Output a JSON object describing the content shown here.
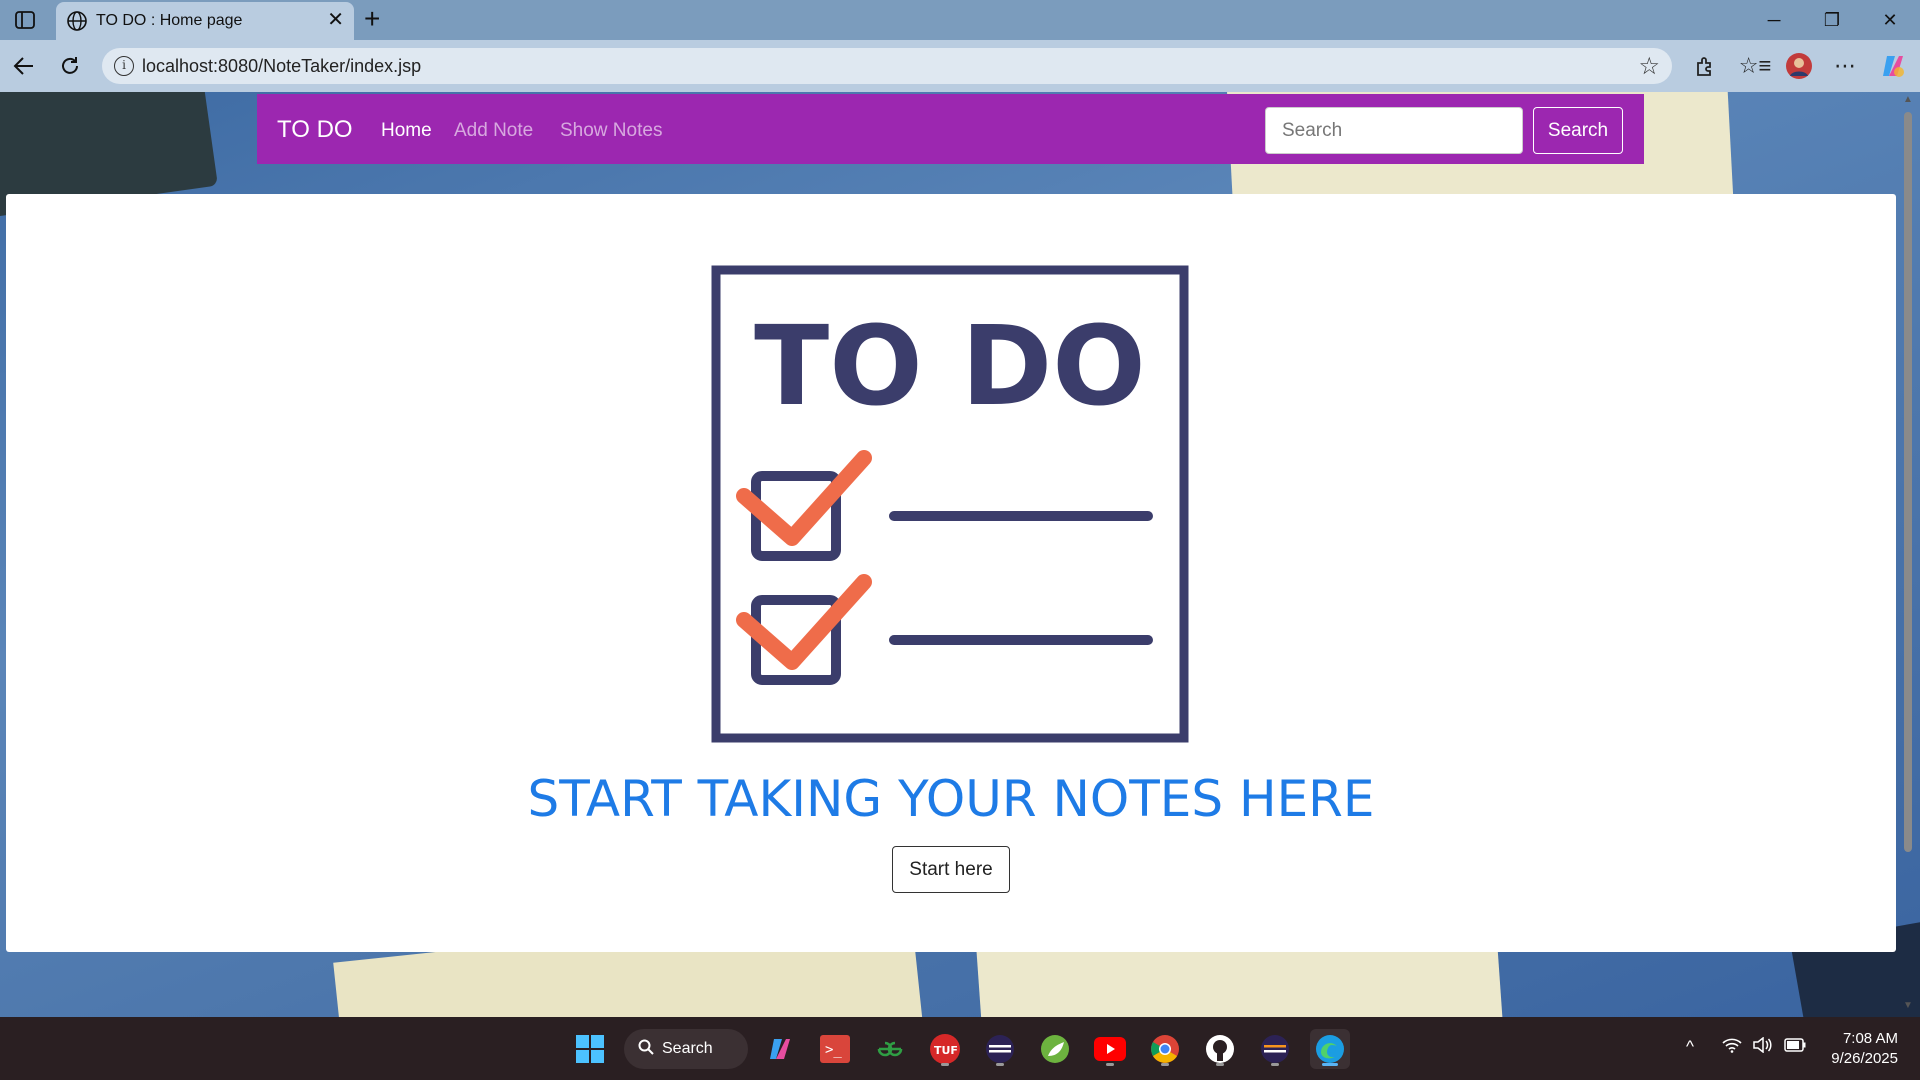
{
  "browser": {
    "tab_title": "TO DO : Home page",
    "url": "localhost:8080/NoteTaker/index.jsp"
  },
  "navbar": {
    "brand": "TO DO",
    "links": [
      {
        "label": "Home",
        "active": true
      },
      {
        "label": "Add Note",
        "active": false
      },
      {
        "label": "Show Notes",
        "active": false
      }
    ],
    "search_placeholder": "Search",
    "search_button": "Search",
    "color": "#9c27b0"
  },
  "main": {
    "illustration_title": "TO DO",
    "headline": "START TAKING YOUR NOTES HERE",
    "start_button": "Start here",
    "headline_color": "#1e7be6",
    "illustration_colors": {
      "ink": "#3b3d6b",
      "check": "#ef6c4a"
    }
  },
  "taskbar": {
    "search_label": "Search",
    "apps": [
      "copilot-icon",
      "terminal-icon",
      "geeksforgeeks-icon",
      "tuf-icon",
      "eclipse-icon",
      "spring-icon",
      "youtube-icon",
      "chrome-icon",
      "github-icon",
      "eclipse-icon-2",
      "edge-icon"
    ],
    "time": "7:08 AM",
    "date": "9/26/2025"
  }
}
